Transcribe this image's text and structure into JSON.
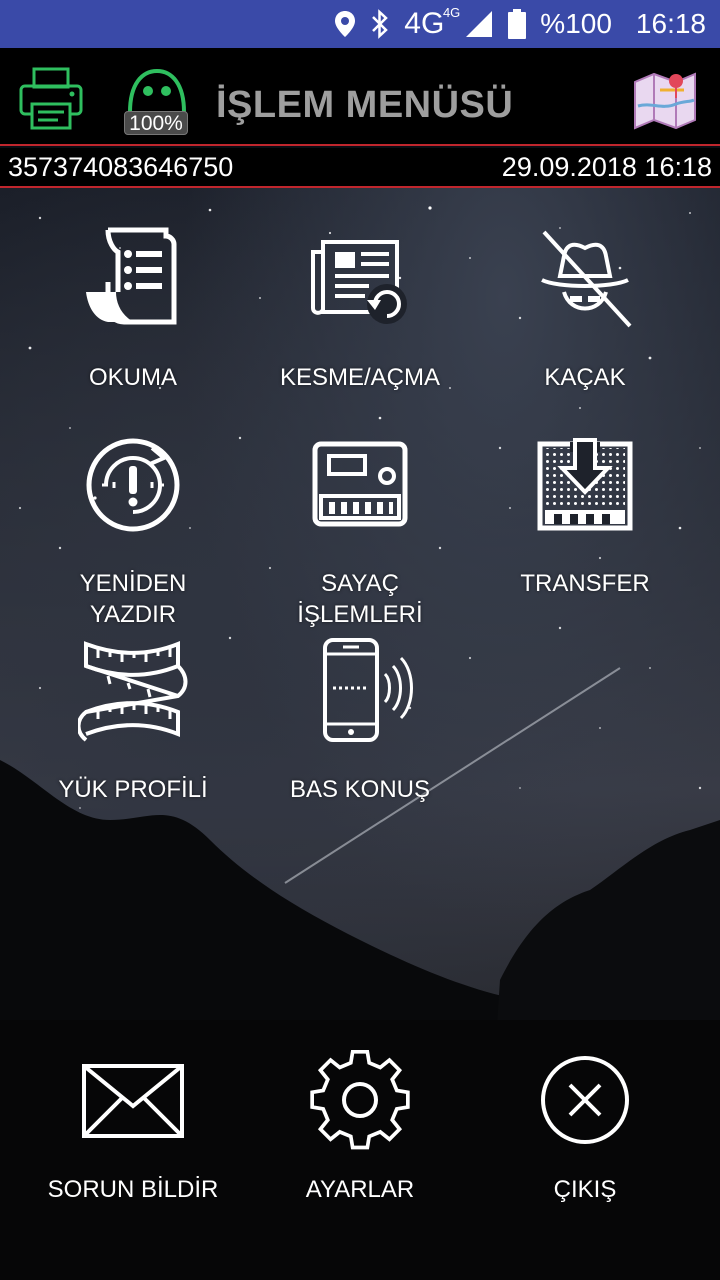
{
  "status_bar": {
    "icons": [
      "location-icon",
      "bluetooth-icon",
      "signal-icon",
      "battery-icon"
    ],
    "network": "4G",
    "network_small": "4G",
    "battery": "%100",
    "time": "16:18"
  },
  "header": {
    "title": "İŞLEM MENÜSÜ",
    "robot_badge": "100%",
    "printer_color": "#2fbf5f",
    "accent_color": "#c0262d"
  },
  "info": {
    "device_id": "357374083646750",
    "datetime": "29.09.2018 16:18"
  },
  "menu": {
    "items": [
      {
        "label": "OKUMA",
        "icon": "reading-list-icon"
      },
      {
        "label": "KESME/AÇMA",
        "icon": "document-refresh-icon"
      },
      {
        "label": "KAÇAK",
        "icon": "spy-hat-icon"
      },
      {
        "label_line1": "YENİDEN",
        "label_line2": "YAZDIR",
        "icon": "reprint-icon"
      },
      {
        "label_line1": "SAYAÇ",
        "label_line2": "İŞLEMLERİ",
        "icon": "meter-icon"
      },
      {
        "label": "TRANSFER",
        "icon": "transfer-icon"
      },
      {
        "label": "YÜK PROFİLİ",
        "icon": "tape-measure-icon"
      },
      {
        "label": "BAS KONUŞ",
        "icon": "phone-signal-icon"
      }
    ]
  },
  "bottom": {
    "report": "SORUN BİLDİR",
    "settings": "AYARLAR",
    "exit": "ÇIKIŞ"
  }
}
